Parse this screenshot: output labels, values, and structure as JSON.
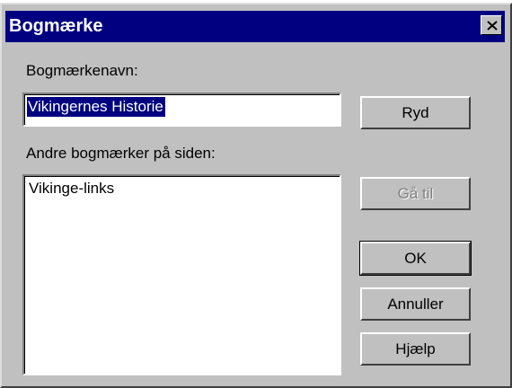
{
  "window": {
    "title": "Bogmærke",
    "close_icon": "close-icon"
  },
  "bookmark_name": {
    "label": "Bogmærkenavn:",
    "value": "Vikingernes Historie"
  },
  "other_bookmarks": {
    "label": "Andre bogmærker på siden:",
    "items": [
      "Vikinge-links"
    ]
  },
  "buttons": {
    "clear": "Ryd",
    "goto": "Gå til",
    "ok": "OK",
    "cancel": "Annuller",
    "help": "Hjælp"
  },
  "colors": {
    "titlebar": "#000080",
    "face": "#c0c0c0",
    "selection": "#000080"
  }
}
